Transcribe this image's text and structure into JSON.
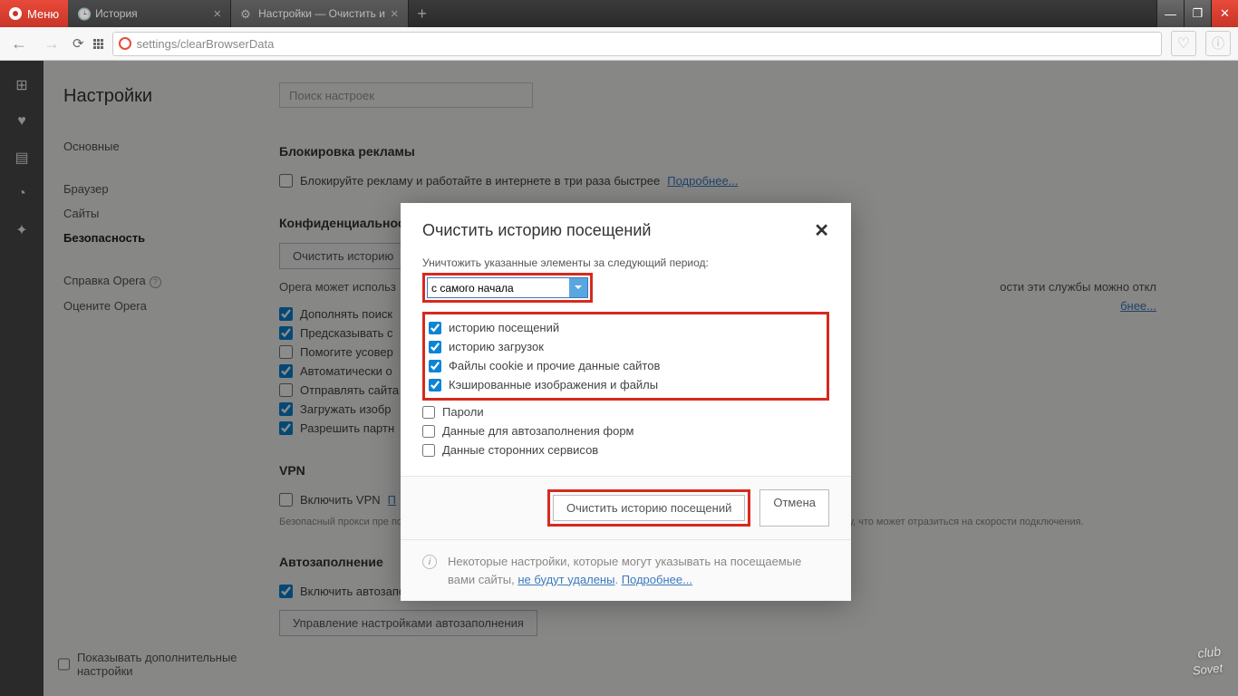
{
  "titlebar": {
    "menu": "Меню"
  },
  "tabs": [
    {
      "title": "История",
      "active": false
    },
    {
      "title": "Настройки — Очистить и",
      "active": true
    }
  ],
  "address": {
    "url": "settings/clearBrowserData"
  },
  "sidebar_icons": [
    "apps",
    "heart",
    "news",
    "clock",
    "puzzle"
  ],
  "settings": {
    "heading": "Настройки",
    "search_placeholder": "Поиск настроек",
    "nav": {
      "main": [
        "Основные"
      ],
      "second": [
        "Браузер",
        "Сайты",
        "Безопасность"
      ],
      "third": [
        "Справка Opera",
        "Оцените Opera"
      ]
    },
    "show_adv": "Показывать дополнительные настройки"
  },
  "sections": {
    "adblock": {
      "title": "Блокировка рекламы",
      "cb": "Блокируйте рекламу и работайте в интернете в три раза быстрее",
      "more": "Подробнее..."
    },
    "privacy": {
      "title": "Конфиденциальность",
      "clear_btn": "Очистить историю",
      "desc_prefix": "Opera может использ",
      "desc_suffix": "ости эти службы можно откл",
      "more": "бнее...",
      "checks": [
        "Дополнять поиск",
        "Предсказывать с",
        "Помогите усовер",
        "Автоматически о",
        "Отправлять сайта",
        "Загружать изобр",
        "Разрешить партн"
      ]
    },
    "vpn": {
      "title": "VPN",
      "cb": "Включить VPN",
      "link": "П",
      "desc": "Безопасный прокси пре\nподтверждаете согласие\nVPN подключается к веб-сайтам через различные серверы по всему миру, что может отразиться на скорости подключения.",
      "more": "ы"
    },
    "autofill": {
      "title": "Автозаполнение",
      "cb": "Включить автозаполнение форм на страницах",
      "btn": "Управление настройками автозаполнения"
    }
  },
  "dialog": {
    "title": "Очистить историю посещений",
    "period_label": "Уничтожить указанные элементы за следующий период:",
    "period_value": "с самого начала",
    "checks": [
      {
        "label": "историю посещений",
        "checked": true,
        "red": true
      },
      {
        "label": "историю загрузок",
        "checked": true,
        "red": true
      },
      {
        "label": "Файлы cookie и прочие данные сайтов",
        "checked": true,
        "red": true
      },
      {
        "label": "Кэшированные изображения и файлы",
        "checked": true,
        "red": true
      },
      {
        "label": "Пароли",
        "checked": false,
        "red": false
      },
      {
        "label": "Данные для автозаполнения форм",
        "checked": false,
        "red": false
      },
      {
        "label": "Данные сторонних сервисов",
        "checked": false,
        "red": false
      }
    ],
    "clear_btn": "Очистить историю посещений",
    "cancel_btn": "Отмена",
    "info_text": "Некоторые настройки, которые могут указывать на посещаемые вами сайты,",
    "info_link1": "не будут удалены",
    "info_sep": ". ",
    "info_link2": "Подробнее..."
  },
  "watermark": {
    "top": "club",
    "main": "Sovet"
  }
}
